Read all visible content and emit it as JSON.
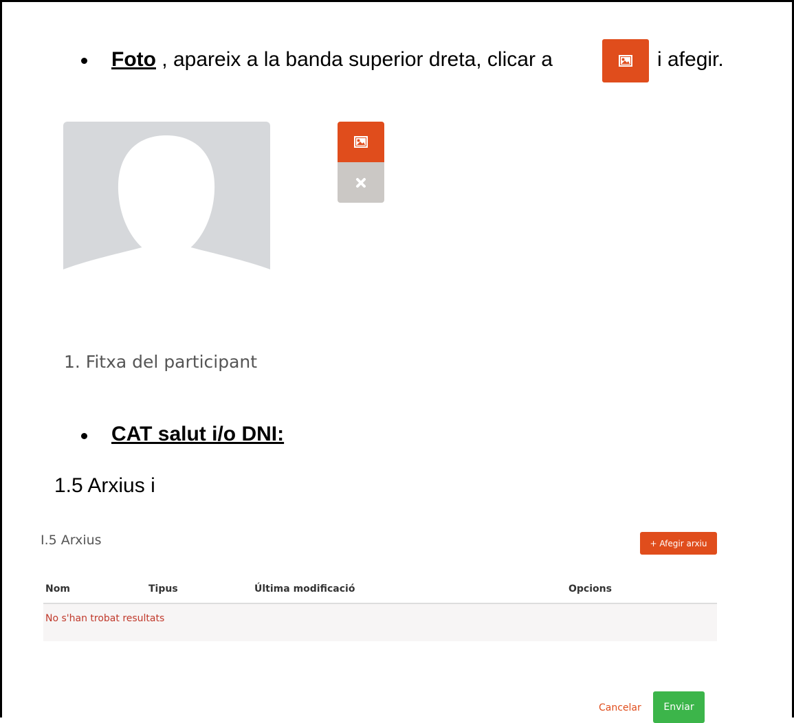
{
  "foto_bullet": {
    "link_text": "Foto",
    "text_before_button": " , apareix a la banda superior dreta, clicar a",
    "text_after_button": "i afegir."
  },
  "photo_widget": {
    "icons": [
      "image-icon",
      "close-icon"
    ],
    "colors": {
      "add": "#e04d1c",
      "remove": "#cbc8c5",
      "placeholder": "#d6d8db"
    }
  },
  "section_heading": "1. Fitxa del participant",
  "cat_bullet": "CAT salut i/o DNI:",
  "arxius_heading": "1.5 Arxius i",
  "files_panel": {
    "title": "I.5 Arxius",
    "add_button": "+ Afegir arxiu",
    "columns": [
      "Nom",
      "Tipus",
      "Última modificació",
      "Opcions"
    ],
    "empty_message": "No s'han trobat resultats",
    "cancel_label": "Cancelar",
    "send_label": "Enviar"
  }
}
